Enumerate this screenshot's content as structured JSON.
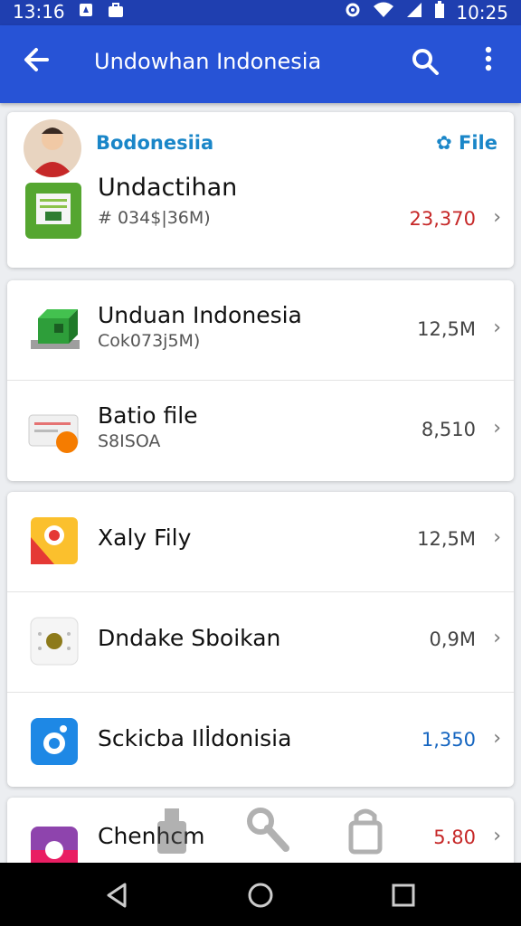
{
  "status": {
    "time_left": "13:16",
    "time_right": "10:25"
  },
  "appbar": {
    "back_icon": "arrow-left-icon",
    "title": "Undowhan Indonesia",
    "search_icon": "search-icon",
    "more_icon": "more-vert-icon"
  },
  "header_card": {
    "label": "Bodonesiia",
    "file_button": "✿ File",
    "item": {
      "name": "Undactihan",
      "sub": "# 034$|36M)",
      "value": "23,370"
    }
  },
  "card2": [
    {
      "name": "Unduan Indonesia",
      "sub": "Cok073j5M)",
      "value": "12,5M"
    },
    {
      "name": "Batio file",
      "sub": "S8ISOA",
      "value": "8,510"
    }
  ],
  "card3": [
    {
      "name": "Xaly Fily",
      "value": "12,5M"
    },
    {
      "name": "Dndake Sboikan",
      "value": "0,9M"
    },
    {
      "name": "Sckicba Ill̇donisia",
      "value": "1,350"
    }
  ],
  "card4": {
    "name": "Chenhcm",
    "value": "5.80"
  },
  "colors": {
    "appbar": "#2753d6",
    "statusbar": "#1f3fb0",
    "accent_blue": "#1a73e8",
    "value_red": "#c62828",
    "value_blue": "#1565c0"
  }
}
